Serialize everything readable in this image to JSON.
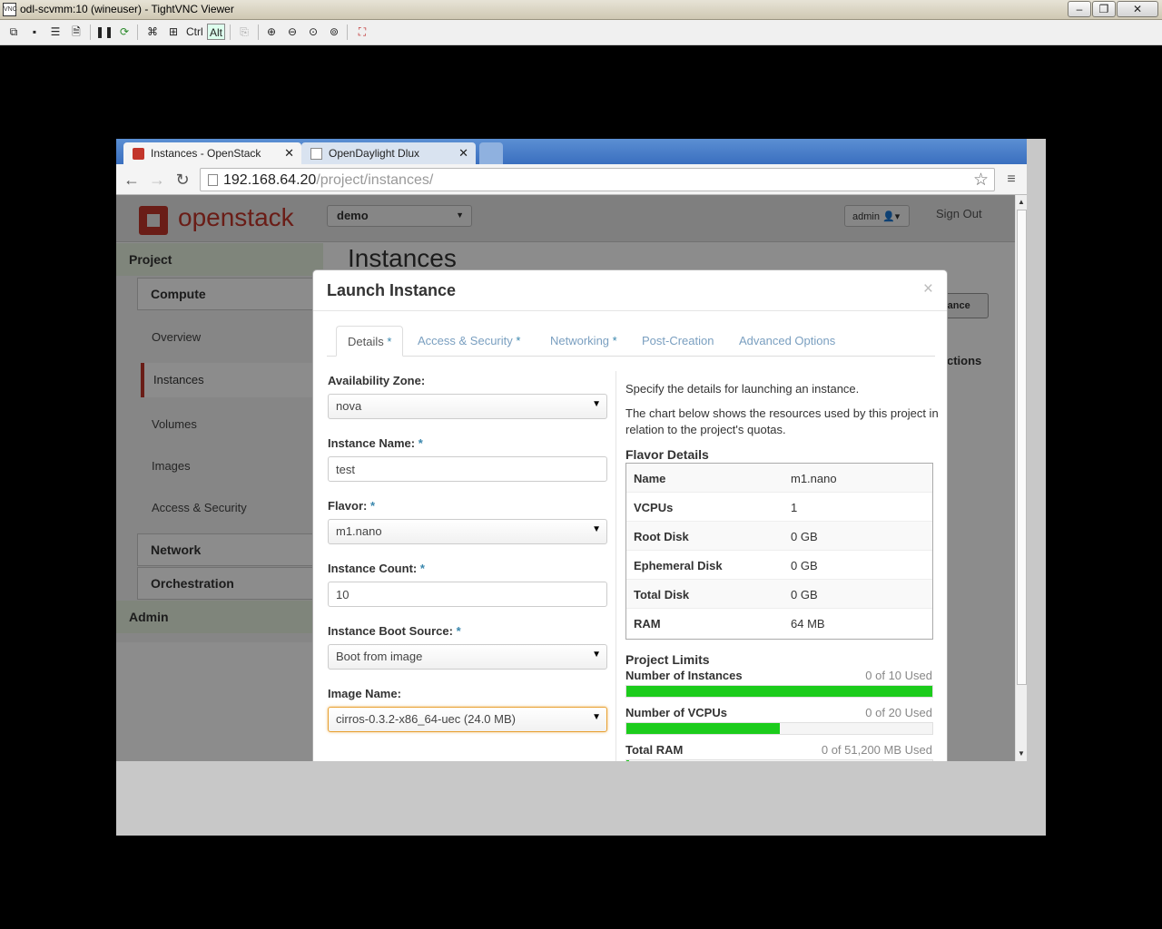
{
  "vnc": {
    "title": "odl-scvmm:10 (wineuser) - TightVNC Viewer",
    "toolbar": {
      "ctrl": "Ctrl",
      "alt": "Alt"
    }
  },
  "browser": {
    "tabs": [
      {
        "label": "Instances - OpenStack",
        "active": true
      },
      {
        "label": "OpenDaylight Dlux",
        "active": false
      }
    ],
    "url_host": "192.168.64.20",
    "url_path": "/project/instances/"
  },
  "openstack": {
    "logo": "openstack",
    "project": "demo",
    "user": "admin",
    "sign_out": "Sign Out",
    "page_title": "Instances",
    "launch_button_partial": "tance",
    "actions_partial": "ctions",
    "sidebar": {
      "project": "Project",
      "compute": "Compute",
      "items": [
        "Overview",
        "Instances",
        "Volumes",
        "Images",
        "Access & Security"
      ],
      "network": "Network",
      "orchestration": "Orchestration",
      "admin": "Admin"
    }
  },
  "modal": {
    "title": "Launch Instance",
    "close": "×",
    "tabs": [
      {
        "label": "Details",
        "required": "*"
      },
      {
        "label": "Access & Security",
        "required": "*"
      },
      {
        "label": "Networking",
        "required": "*"
      },
      {
        "label": "Post-Creation",
        "required": ""
      },
      {
        "label": "Advanced Options",
        "required": ""
      }
    ],
    "form": {
      "availability_zone": {
        "label": "Availability Zone:",
        "value": "nova"
      },
      "instance_name": {
        "label": "Instance Name:",
        "value": "test"
      },
      "flavor": {
        "label": "Flavor:",
        "value": "m1.nano"
      },
      "instance_count": {
        "label": "Instance Count:",
        "value": "10"
      },
      "boot_source": {
        "label": "Instance Boot Source:",
        "value": "Boot from image"
      },
      "image_name": {
        "label": "Image Name:",
        "value": "cirros-0.3.2-x86_64-uec (24.0 MB)"
      },
      "required_mark": "*"
    },
    "info": {
      "p1": "Specify the details for launching an instance.",
      "p2": "The chart below shows the resources used by this project in relation to the project's quotas."
    },
    "flavor_details": {
      "title": "Flavor Details",
      "rows": [
        {
          "key": "Name",
          "value": "m1.nano"
        },
        {
          "key": "VCPUs",
          "value": "1"
        },
        {
          "key": "Root Disk",
          "value": "0 GB"
        },
        {
          "key": "Ephemeral Disk",
          "value": "0 GB"
        },
        {
          "key": "Total Disk",
          "value": "0 GB"
        },
        {
          "key": "RAM",
          "value": "64 MB"
        }
      ]
    },
    "project_limits": {
      "title": "Project Limits",
      "items": [
        {
          "name": "Number of Instances",
          "used": "0 of 10 Used",
          "fill_fraction": 1.0
        },
        {
          "name": "Number of VCPUs",
          "used": "0 of 20 Used",
          "fill_fraction": 0.5
        },
        {
          "name": "Total RAM",
          "used": "0 of 51,200 MB Used",
          "fill_fraction": 0.01
        }
      ]
    }
  },
  "colors": {
    "limit_fill": "#1ccc1c",
    "openstack_red": "#c2352a",
    "highlight_border": "#e8a030"
  }
}
